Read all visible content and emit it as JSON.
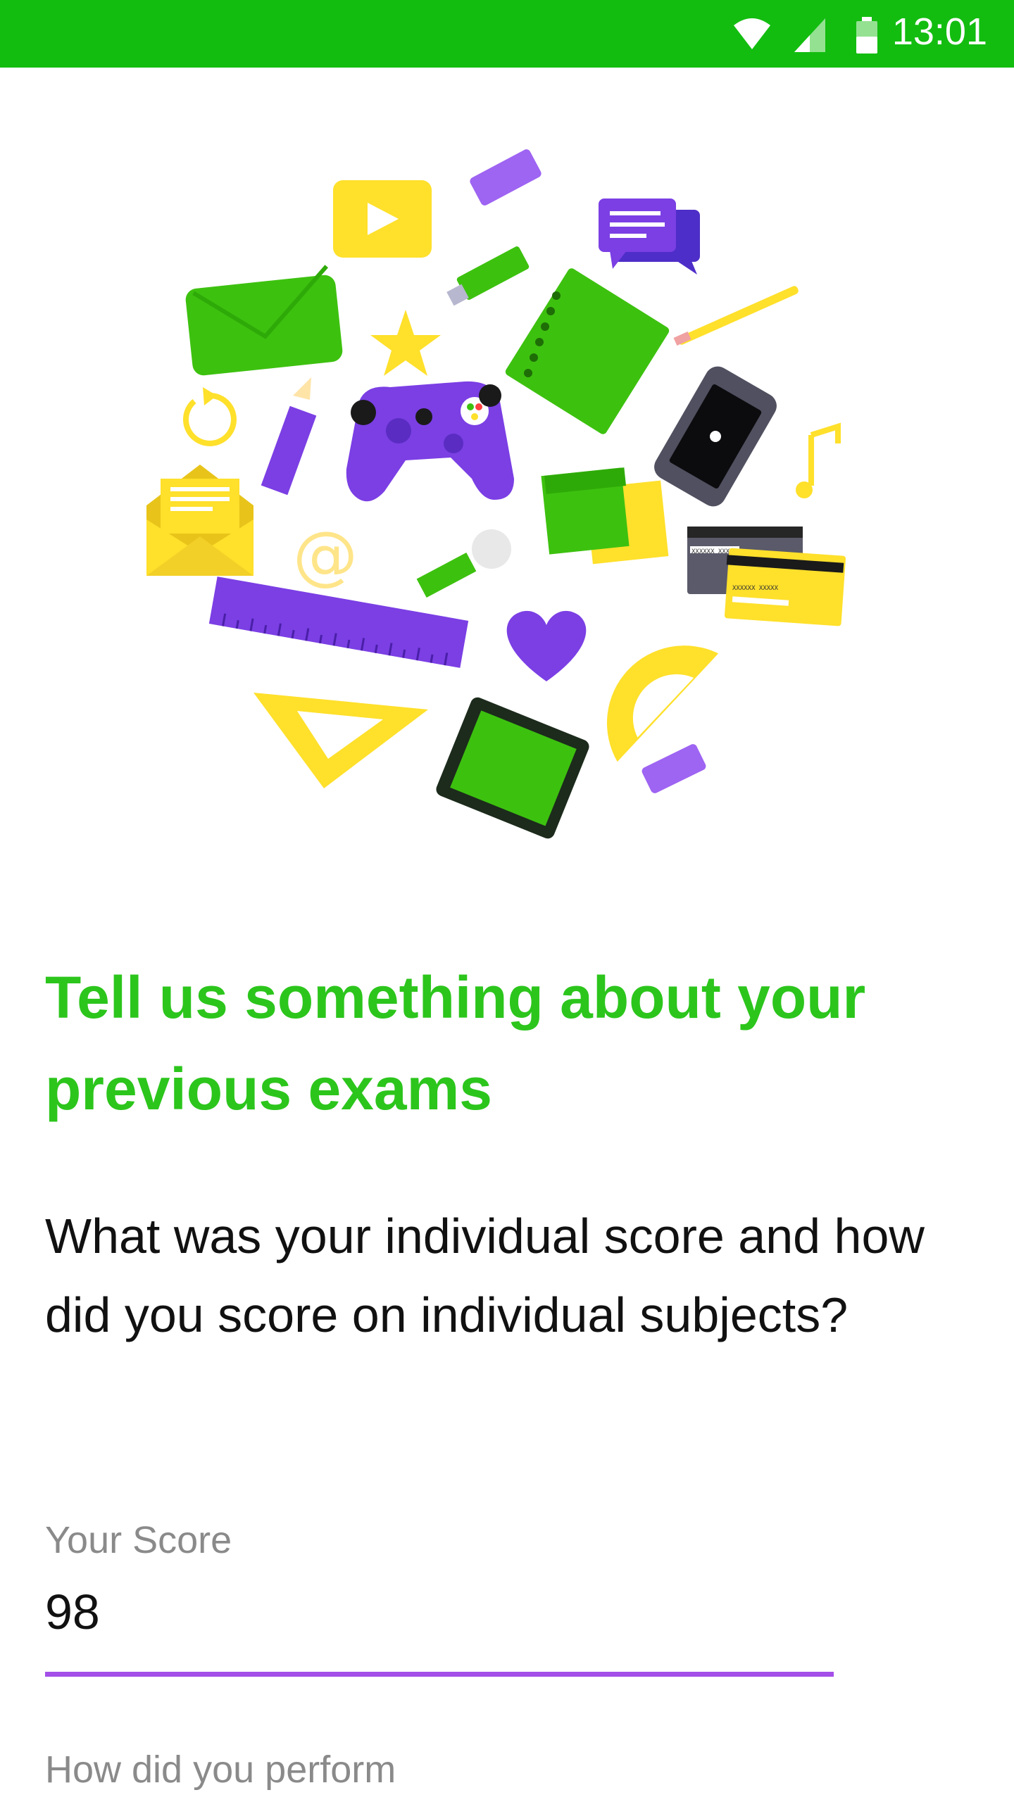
{
  "status_bar": {
    "time": "13:01",
    "icons": [
      "wifi-icon",
      "cell-signal-icon",
      "battery-icon"
    ],
    "background": "#12bd0f"
  },
  "illustration": {
    "description_icons": [
      "play-icon",
      "eraser-icon",
      "chat-icon",
      "envelope-icon",
      "usb-icon",
      "notebook-icon",
      "pencil-icon",
      "star-icon",
      "refresh-icon",
      "smartphone-icon",
      "music-note-icon",
      "gamepad-icon",
      "sticky-note-icon",
      "open-envelope-icon",
      "at-sign-icon",
      "wrench-icon",
      "credit-card-icon",
      "ruler-icon",
      "heart-icon",
      "protractor-icon",
      "triangle-ruler-icon",
      "tablet-icon"
    ],
    "apple_logo_glyph": "",
    "card_text_1": "XXXXXX XXXXX",
    "card_text_2": "XXXXXX XXXXX"
  },
  "content": {
    "heading": "Tell us something about your previous exams",
    "question": "What was your individual score and how did you score on individual subjects?",
    "score_label": "Your Score",
    "score_value": "98",
    "perform_label": "How did you perform"
  },
  "colors": {
    "accent_green": "#2cc51c",
    "accent_purple": "#a34fe8",
    "label_gray": "#8a8a8a"
  }
}
